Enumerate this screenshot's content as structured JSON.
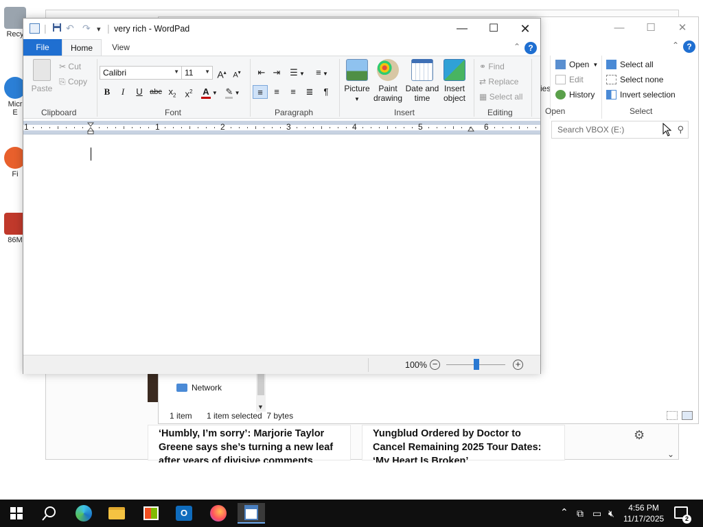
{
  "desktop": {
    "icons": [
      {
        "label": "Recy",
        "color": "#9aa4ae"
      },
      {
        "label": "Micr\nE",
        "color": "#2b7fd6"
      },
      {
        "label": "Fi",
        "color": "#e8602c"
      },
      {
        "label": "86M",
        "color": "#c0392b"
      }
    ]
  },
  "browser": {
    "news": [
      {
        "headline": "‘Humbly, I’m sorry’: Marjorie Taylor Greene says she’s turning a new leaf after years of divisive comments"
      },
      {
        "headline": "Yungblud Ordered by Doctor to Cancel Remaining 2025 Tour Dates: ‘My Heart Is Broken’"
      }
    ]
  },
  "explorer": {
    "open_group": {
      "open_label": "Open",
      "edit_label": "Edit",
      "history_label": "History",
      "group_label": "Open",
      "partial_label": "ies"
    },
    "select_group": {
      "select_all": "Select all",
      "select_none": "Select none",
      "invert_selection": "Invert selection",
      "group_label": "Select"
    },
    "search_placeholder": "Search VBOX (E:)",
    "nav_network": "Network",
    "status_items": "1 item",
    "status_selected": "1 item selected  7 bytes"
  },
  "wordpad": {
    "title": "very rich - WordPad",
    "tabs": {
      "file": "File",
      "home": "Home",
      "view": "View"
    },
    "clipboard": {
      "paste": "Paste",
      "cut": "Cut",
      "copy": "Copy",
      "group_label": "Clipboard"
    },
    "font": {
      "family": "Calibri",
      "size": "11",
      "group_label": "Font"
    },
    "paragraph": {
      "group_label": "Paragraph"
    },
    "insert": {
      "picture": "Picture",
      "paint_drawing_1": "Paint",
      "paint_drawing_2": "drawing",
      "date_time_1": "Date and",
      "date_time_2": "time",
      "insert_object_1": "Insert",
      "insert_object_2": "object",
      "group_label": "Insert"
    },
    "editing": {
      "find": "Find",
      "replace": "Replace",
      "select_all": "Select all",
      "group_label": "Editing"
    },
    "ruler_numbers": [
      "1",
      "1",
      "2",
      "3",
      "4",
      "5",
      "6"
    ],
    "zoom": "100%"
  },
  "taskbar": {
    "clock_time": "4:56 PM",
    "clock_date": "11/17/2025",
    "notification_count": "2"
  }
}
